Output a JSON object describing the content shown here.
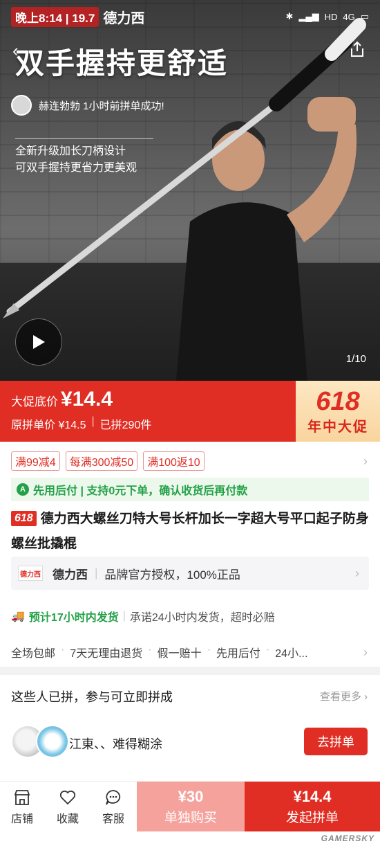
{
  "status_bar": {
    "time": "晚上8:14",
    "speed": "19.7",
    "brand_overlay": "德力西",
    "network": "4G",
    "hd": "HD"
  },
  "hero": {
    "title": "双手握持更舒适",
    "notification": "赫连勃勃 1小时前拼单成功!",
    "desc_line1": "全新升级加长刀柄设计",
    "desc_line2": "可双手握持更省力更美观",
    "page_indicator": "1/10"
  },
  "price": {
    "promo_label": "大促底价",
    "promo_price": "¥14.4",
    "orig_label": "原拼单价 ¥14.5",
    "sold": "已拼290件",
    "badge_number": "618",
    "badge_text": "年中大促"
  },
  "coupons": [
    "满99减4",
    "每满300减50",
    "满100返10"
  ],
  "pay_later": {
    "icon": "A",
    "text": "先用后付 | 支持0元下单，确认收货后再付款"
  },
  "product": {
    "tag": "618",
    "title": "德力西大螺丝刀特大号长杆加长一字超大号平口起子防身螺丝批撬棍"
  },
  "store": {
    "logo_text": "德力西",
    "name": "德力西",
    "auth": "品牌官方授权，100%正品"
  },
  "shipping": {
    "estimate": "预计17小时内发货",
    "promise": "承诺24小时内发货，超时必赔"
  },
  "services": [
    "全场包邮",
    "7天无理由退货",
    "假一赔十",
    "先用后付",
    "24小..."
  ],
  "group": {
    "heading": "这些人已拼，参与可立即拼成",
    "see_more": "查看更多 ›",
    "names": "江東、、难得糊涂",
    "join_label": "去拼单"
  },
  "bottom_bar": {
    "store_label": "店铺",
    "fav_label": "收藏",
    "service_label": "客服",
    "solo_price": "¥30",
    "solo_label": "单独购买",
    "group_price": "¥14.4",
    "group_label": "发起拼单"
  },
  "watermark": "GAMERSKY",
  "colors": {
    "brand_red": "#e02e24",
    "green": "#24a148",
    "solo_pink": "#f5a29c"
  }
}
